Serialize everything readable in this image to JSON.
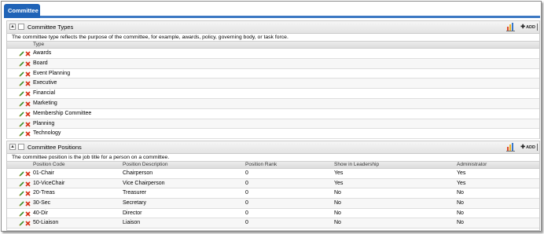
{
  "tab": {
    "label": "Committee"
  },
  "types_panel": {
    "title": "Committee Types",
    "description": "The committee type reflects the purpose of the committee, for example, awards, policy, governing body, or task force.",
    "column_header": "Type",
    "add_label": "ADD",
    "rows": [
      "Awards",
      "Board",
      "Event Planning",
      "Executive",
      "Financial",
      "Marketing",
      "Membership Committee",
      "Planning",
      "Technology"
    ]
  },
  "positions_panel": {
    "title": "Committee Positions",
    "description": "The committee position is the job title for a person on a committee.",
    "add_label": "ADD",
    "columns": {
      "code": "Position Code",
      "description": "Position Description",
      "rank": "Position Rank",
      "show": "Show in Leadership",
      "admin": "Administrator"
    },
    "rows": [
      {
        "code": "01-Chair",
        "description": "Chairperson",
        "rank": "0",
        "show": "Yes",
        "admin": "Yes"
      },
      {
        "code": "10-ViceChair",
        "description": "Vice Chairperson",
        "rank": "0",
        "show": "Yes",
        "admin": "Yes"
      },
      {
        "code": "20-Treas",
        "description": "Treasurer",
        "rank": "0",
        "show": "No",
        "admin": "No"
      },
      {
        "code": "30-Sec",
        "description": "Secretary",
        "rank": "0",
        "show": "No",
        "admin": "No"
      },
      {
        "code": "40-Dir",
        "description": "Director",
        "rank": "0",
        "show": "No",
        "admin": "No"
      },
      {
        "code": "50-Liaison",
        "description": "Liaison",
        "rank": "0",
        "show": "No",
        "admin": "No"
      }
    ]
  },
  "icons": {
    "collapse": "collapse-up-icon",
    "maximize": "square-icon",
    "chart": "bar-chart-icon",
    "edit": "pencil-icon",
    "delete": "red-x-icon"
  },
  "colors": {
    "tab": "#1f63b7",
    "tab_border": "#3c78c3",
    "edit": "#3f8f2a",
    "delete": "#d9361c"
  }
}
